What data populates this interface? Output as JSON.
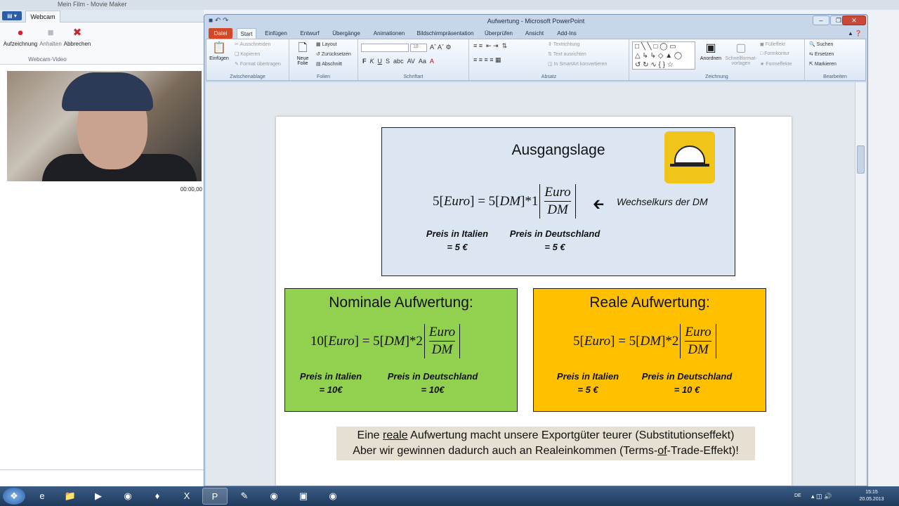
{
  "moviemaker": {
    "title": "Mein Film - Movie Maker",
    "tab": "Webcam",
    "file_btn": "▤ ▾",
    "buttons": [
      {
        "label": "Aufzeichnung",
        "glyph": "●",
        "color": "#d81f26"
      },
      {
        "label": "Anhalten",
        "glyph": "■",
        "color": "#b5bcc8"
      },
      {
        "label": "Abbrechen",
        "glyph": "✖",
        "color": "#c9252c"
      }
    ],
    "group_label": "Webcam-Video",
    "timer": "00:00,00"
  },
  "powerpoint": {
    "title": "Aufwertung - Microsoft PowerPoint",
    "tabs": [
      "Datei",
      "Start",
      "Einfügen",
      "Entwurf",
      "Übergänge",
      "Animationen",
      "Bildschirmpräsentation",
      "Überprüfen",
      "Ansicht",
      "Add-Ins"
    ],
    "ribbon": {
      "clipboard": {
        "paste": "Einfügen",
        "cut": "Ausschneiden",
        "copy": "Kopieren",
        "format": "Format übertragen",
        "label": "Zwischenablage"
      },
      "slides": {
        "new": "Neue Folie",
        "layout": "Layout",
        "reset": "Zurücksetzen",
        "section": "Abschnitt",
        "label": "Folien"
      },
      "font": {
        "size": "18",
        "label": "Schriftart"
      },
      "paragraph": {
        "direction": "Textrichtung",
        "align": "Text ausrichten",
        "smartart": "In SmartArt konvertieren",
        "label": "Absatz"
      },
      "drawing": {
        "arrange": "Anordnen",
        "quickstyles": "Schnellformat-vorlagen",
        "fill": "Fülleffekt",
        "outline": "Formkontur",
        "effects": "Formeffekte",
        "label": "Zeichnung"
      },
      "editing": {
        "find": "Suchen",
        "replace": "Ersetzen",
        "select": "Markieren",
        "label": "Bearbeiten"
      }
    }
  },
  "slide": {
    "top": {
      "title": "Ausgangslage",
      "eq_left": "5",
      "eq_mid": "= 5",
      "eq_factor": "*1",
      "unit_euro": "Euro",
      "unit_dm": "DM",
      "annotation": "Wechselkurs  der DM",
      "price_left": "Preis in Italien",
      "price_left_val": "= 5 €",
      "price_right": "Preis in Deutschland",
      "price_right_val": "= 5 €",
      "icon": "hat-icon",
      "accent": "#f0c419"
    },
    "nominal": {
      "title": "Nominale Aufwertung:",
      "eq_left": "10",
      "eq_mid": "= 5",
      "eq_factor": "*2",
      "unit_euro": "Euro",
      "unit_dm": "DM",
      "price_left": "Preis in Italien",
      "price_left_val": "= 10€",
      "price_right": "Preis in Deutschland",
      "price_right_val": "= 10€",
      "bg": "#92d050"
    },
    "real": {
      "title": "Reale Aufwertung:",
      "eq_left": "5",
      "eq_mid": "= 5",
      "eq_factor": "*2",
      "unit_euro": "Euro",
      "unit_dm": "DM",
      "price_left": "Preis in Italien",
      "price_left_val": "= 5 €",
      "price_right": "Preis in Deutschland",
      "price_right_val": "= 10 €",
      "bg": "#ffc000"
    },
    "summary": {
      "l1a": "Eine ",
      "l1b": "reale",
      "l1c": " Aufwertung macht unsere Exportgüter teurer (Substitutionseffekt)",
      "l2a": "Aber wir gewinnen dadurch auch an Realeinkommen (Terms-",
      "l2b": "of",
      "l2c": "-Trade-Effekt)!"
    },
    "top_bg": "#dce6f2"
  },
  "taskbar": {
    "apps": [
      "start-orb",
      "internet-explorer-icon",
      "explorer-icon",
      "media-icon",
      "firefox-icon",
      "acrobat-icon",
      "excel-icon",
      "powerpoint-icon",
      "app-icon",
      "app2-icon",
      "app3-icon",
      "app4-icon"
    ],
    "tray_lang": "DE",
    "time": "15:15",
    "date": "20.05.2013"
  }
}
